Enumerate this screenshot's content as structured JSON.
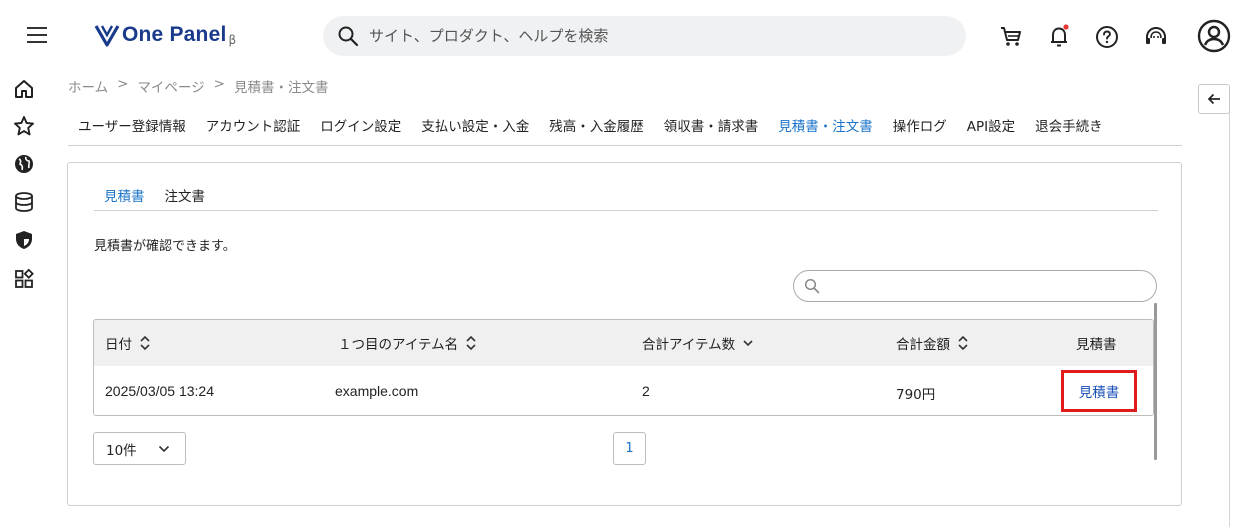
{
  "header": {
    "logo_text": "One Panel",
    "logo_beta": "β",
    "search_placeholder": "サイト、プロダクト、ヘルプを検索"
  },
  "icons": {
    "menu": "hamburger-menu-icon",
    "search": "search-icon",
    "cart": "cart-icon",
    "notification": "bell-icon",
    "help": "help-circle-icon",
    "support": "headset-icon",
    "account": "account-circle-icon",
    "rail": [
      "home-icon",
      "star-icon",
      "globe-icon",
      "database-icon",
      "shield-icon",
      "apps-grid-icon"
    ],
    "collapse": "arrow-left-icon"
  },
  "colors": {
    "accent": "#1a73c8",
    "link": "#1a50b8",
    "highlight_border": "#e01b1b",
    "notification_dot": "#e53935",
    "brand": "#1a3a8c"
  },
  "breadcrumb": [
    "ホーム",
    "マイページ",
    "見積書・注文書"
  ],
  "breadcrumb_separator": ">",
  "main_tabs": [
    {
      "label": "ユーザー登録情報",
      "active": false
    },
    {
      "label": "アカウント認証",
      "active": false
    },
    {
      "label": "ログイン設定",
      "active": false
    },
    {
      "label": "支払い設定・入金",
      "active": false
    },
    {
      "label": "残高・入金履歴",
      "active": false
    },
    {
      "label": "領収書・請求書",
      "active": false
    },
    {
      "label": "見積書・注文書",
      "active": true
    },
    {
      "label": "操作ログ",
      "active": false
    },
    {
      "label": "API設定",
      "active": false
    },
    {
      "label": "退会手続き",
      "active": false
    }
  ],
  "sub_tabs": [
    {
      "label": "見積書",
      "active": true
    },
    {
      "label": "注文書",
      "active": false
    }
  ],
  "description": "見積書が確認できます。",
  "table_search_placeholder": "",
  "table": {
    "headers": [
      "日付",
      "１つ目のアイテム名",
      "合計アイテム数",
      "合計金額",
      "見積書"
    ],
    "rows": [
      {
        "date": "2025/03/05 13:24",
        "item": "example.com",
        "count": "2",
        "amount": "790円",
        "link": "見積書"
      }
    ]
  },
  "pagination": {
    "per_page": "10件",
    "current_page": "1"
  }
}
